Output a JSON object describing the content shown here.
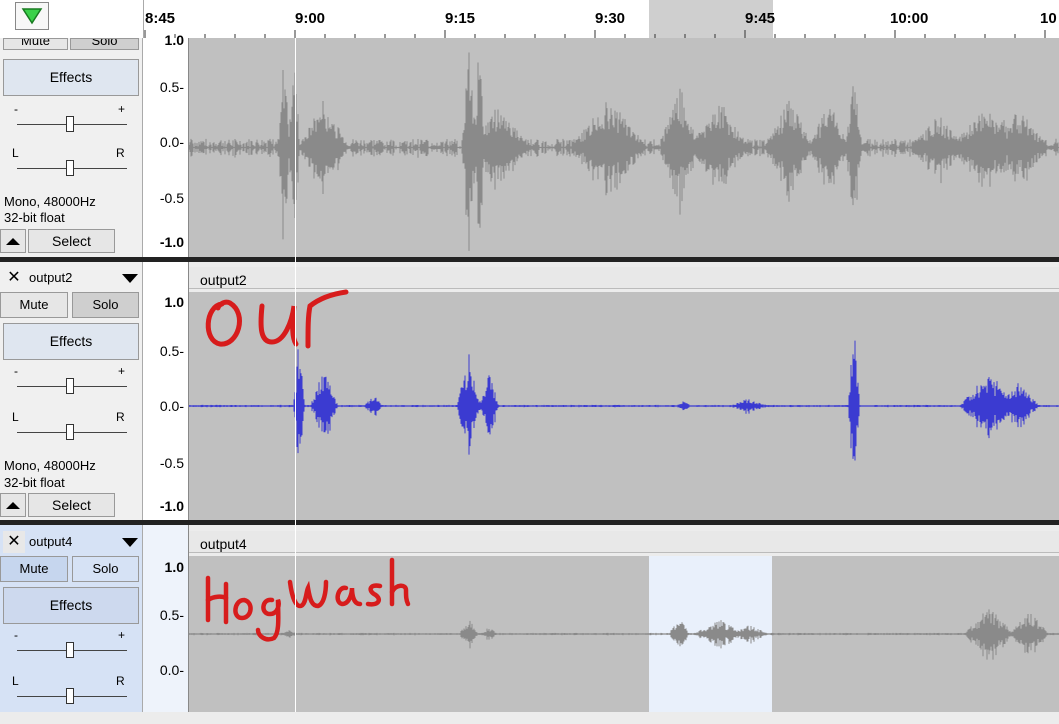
{
  "ruler": {
    "ticks": [
      "8:45",
      "9:00",
      "9:15",
      "9:30",
      "9:45",
      "10:00",
      "10"
    ]
  },
  "tracks": [
    {
      "id": "track1",
      "mute_label": "Mute",
      "solo_label": "Solo",
      "effects_label": "Effects",
      "gain_minus": "-",
      "gain_plus": "+",
      "pan_left": "L",
      "pan_right": "R",
      "format_line1": "Mono, 48000Hz",
      "format_line2": "32-bit float",
      "select_label": "Select",
      "scale": [
        "1.0",
        "0.5-",
        "0.0-",
        "-0.5",
        "-1.0"
      ],
      "wave_color": "#8a8a8a"
    },
    {
      "id": "track2",
      "name": "output2",
      "mute_label": "Mute",
      "solo_label": "Solo",
      "effects_label": "Effects",
      "gain_minus": "-",
      "gain_plus": "+",
      "pan_left": "L",
      "pan_right": "R",
      "format_line1": "Mono, 48000Hz",
      "format_line2": "32-bit float",
      "select_label": "Select",
      "scale": [
        "1.0",
        "0.5-",
        "0.0-",
        "-0.5",
        "-1.0"
      ],
      "wave_color": "#3b3bd1",
      "annotation": "OUr"
    },
    {
      "id": "track3",
      "name": "output4",
      "mute_label": "Mute",
      "solo_label": "Solo",
      "effects_label": "Effects",
      "gain_minus": "-",
      "gain_plus": "+",
      "pan_left": "L",
      "pan_right": "R",
      "scale": [
        "1.0",
        "0.5-",
        "0.0-"
      ],
      "wave_color": "#8a8a8a",
      "annotation": "Hogwash"
    }
  ],
  "colors": {
    "selection_band": "#e9f0fb",
    "annotation_red": "#d71c1c",
    "active_panel": "#d6e2f5"
  }
}
